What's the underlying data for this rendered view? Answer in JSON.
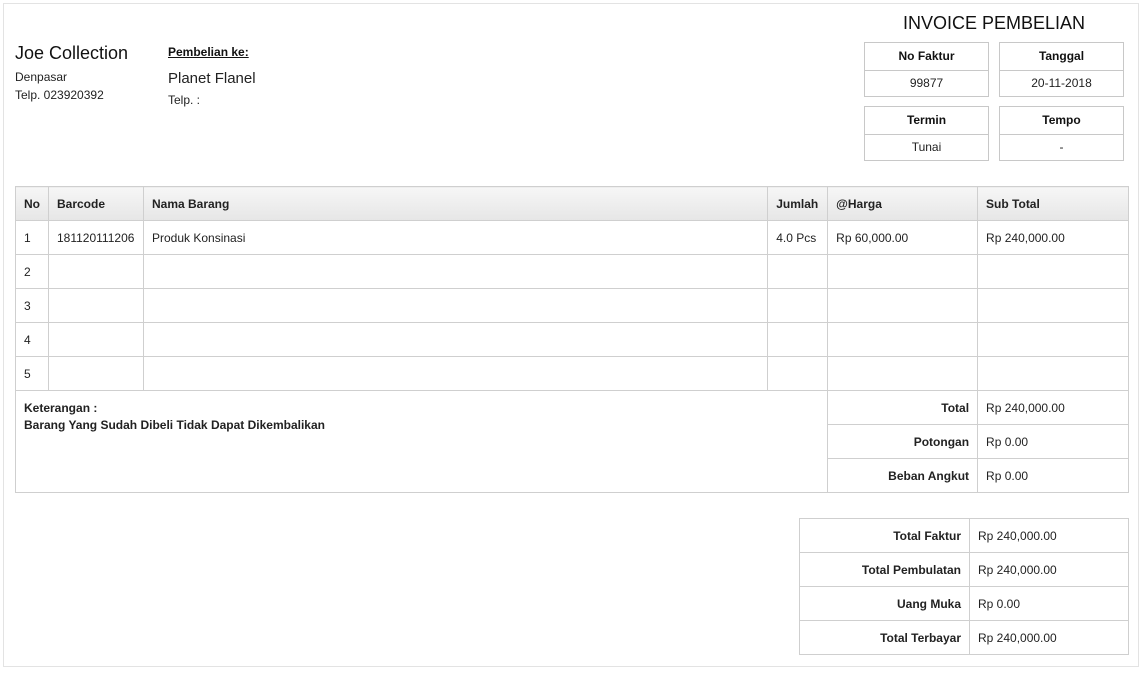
{
  "seller": {
    "name": "Joe Collection",
    "city": "Denpasar",
    "phone": "Telp. 023920392"
  },
  "buyer": {
    "label": "Pembelian ke:",
    "name": "Planet Flanel",
    "phone": "Telp. :"
  },
  "invoice": {
    "title": "INVOICE PEMBELIAN",
    "no_faktur_label": "No Faktur",
    "no_faktur": "99877",
    "tanggal_label": "Tanggal",
    "tanggal": "20-11-2018",
    "termin_label": "Termin",
    "termin": "Tunai",
    "tempo_label": "Tempo",
    "tempo": "-"
  },
  "table": {
    "headers": [
      "No",
      "Barcode",
      "Nama Barang",
      "Jumlah",
      "@Harga",
      "Sub Total"
    ],
    "rows": [
      [
        "1",
        "181120111206",
        "Produk Konsinasi",
        "4.0 Pcs",
        "Rp 60,000.00",
        "Rp 240,000.00"
      ],
      [
        "2",
        "",
        "",
        "",
        "",
        ""
      ],
      [
        "3",
        "",
        "",
        "",
        "",
        ""
      ],
      [
        "4",
        "",
        "",
        "",
        "",
        ""
      ],
      [
        "5",
        "",
        "",
        "",
        "",
        ""
      ]
    ],
    "note_label": "Keterangan :",
    "note_text": "Barang Yang Sudah Dibeli Tidak Dapat Dikembalikan",
    "totals": [
      {
        "label": "Total",
        "value": "Rp 240,000.00"
      },
      {
        "label": "Potongan",
        "value": "Rp 0.00"
      },
      {
        "label": "Beban Angkut",
        "value": "Rp 0.00"
      }
    ]
  },
  "summary": [
    {
      "label": "Total Faktur",
      "value": "Rp 240,000.00"
    },
    {
      "label": "Total Pembulatan",
      "value": "Rp 240,000.00"
    },
    {
      "label": "Uang Muka",
      "value": "Rp 0.00"
    },
    {
      "label": "Total Terbayar",
      "value": "Rp 240,000.00"
    }
  ]
}
